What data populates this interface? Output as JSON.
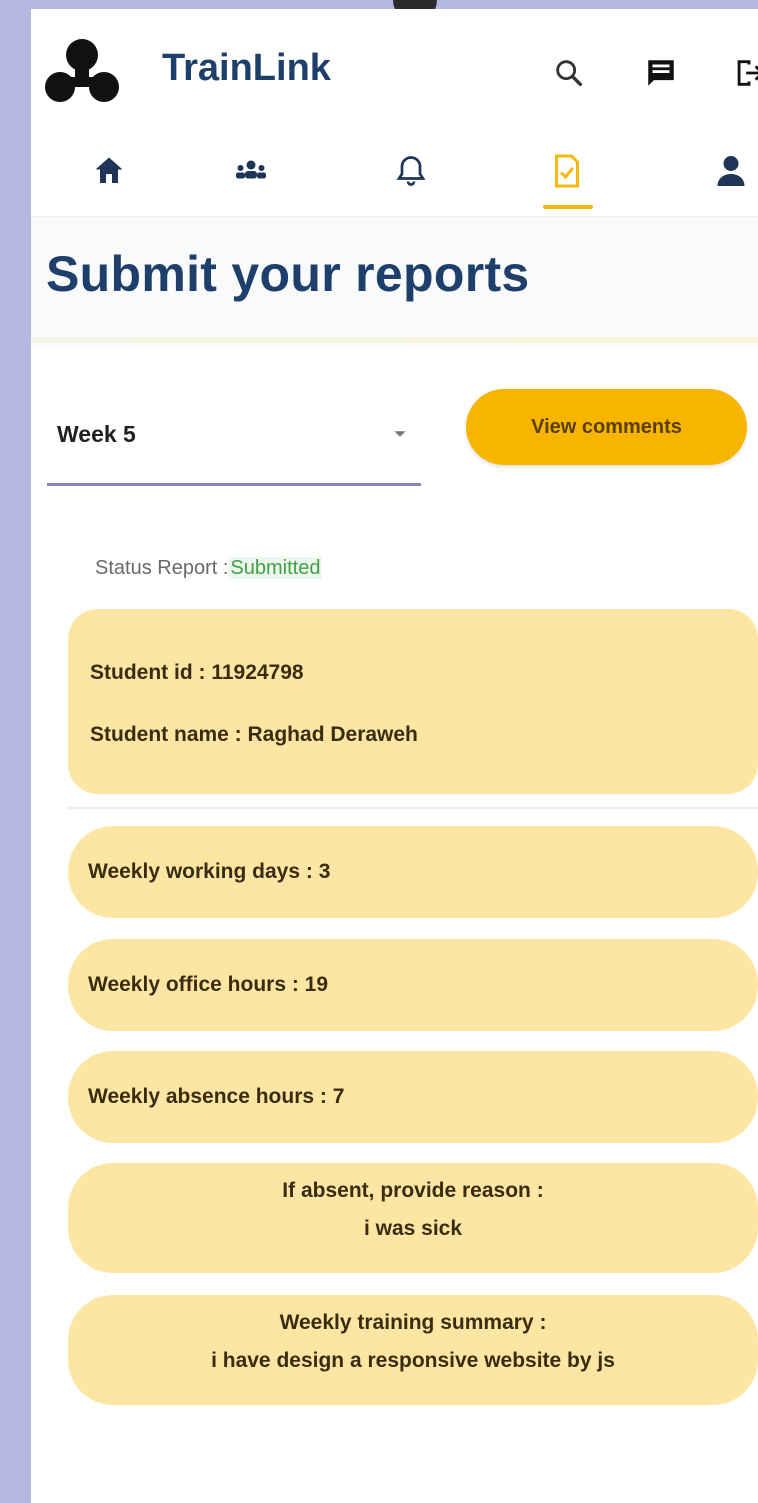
{
  "app": {
    "name": "TrainLink"
  },
  "header": {
    "icons": [
      "search-icon",
      "chat-icon",
      "logout-icon"
    ]
  },
  "nav": {
    "items": [
      {
        "name": "home",
        "icon": "home-icon"
      },
      {
        "name": "groups",
        "icon": "groups-icon"
      },
      {
        "name": "notifications",
        "icon": "bell-icon"
      },
      {
        "name": "reports",
        "icon": "report-check-icon",
        "active": true
      },
      {
        "name": "profile",
        "icon": "person-icon"
      }
    ],
    "active_color": "#f6b90a"
  },
  "page": {
    "title": "Submit your reports"
  },
  "week_select": {
    "selected": "Week 5"
  },
  "view_comments_label": "View comments",
  "status": {
    "label": "Status Report :",
    "value": "Submitted"
  },
  "student": {
    "id_line": "Student id : 11924798",
    "name_line": "Student name : Raghad Deraweh"
  },
  "report": {
    "working_days": "Weekly working days :  3",
    "office_hours": "Weekly office hours :  19",
    "absence_hours": "Weekly absence hours :  7",
    "absent_reason_label": "If absent, provide reason :",
    "absent_reason_value": "i was sick",
    "training_summary_label": "Weekly training summary :",
    "training_summary_value": "i have design a responsive website by js"
  },
  "colors": {
    "brand_text": "#1f3f6b",
    "card_bg": "#fde5a3",
    "button_bg": "#f7b500",
    "status_ok": "#43a047",
    "frame": "#b3b8e0"
  }
}
